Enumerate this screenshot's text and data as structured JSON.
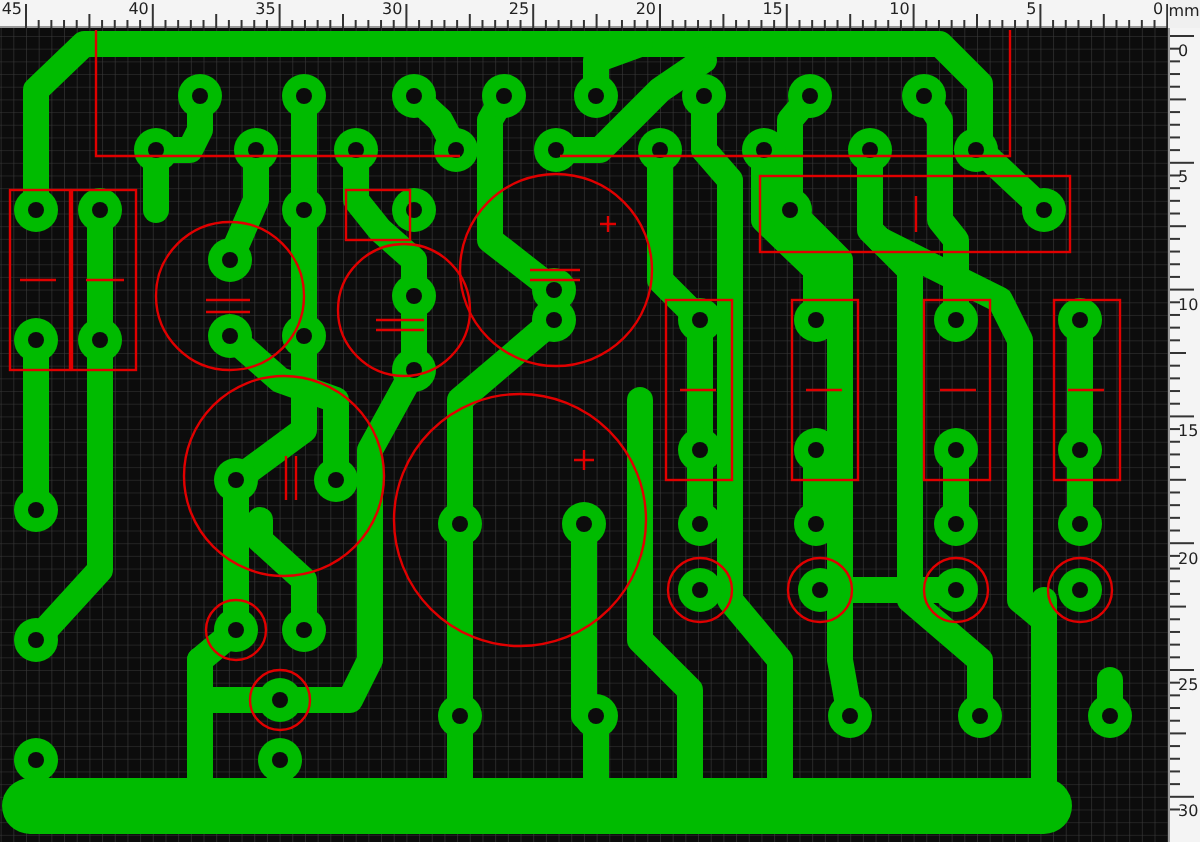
{
  "ruler": {
    "unit": "mm",
    "top_labels": [
      "45",
      "40",
      "35",
      "30",
      "25",
      "20",
      "15",
      "10",
      "5",
      "0"
    ],
    "side_labels": [
      "0",
      "5",
      "10",
      "15",
      "20",
      "25",
      "30"
    ]
  }
}
